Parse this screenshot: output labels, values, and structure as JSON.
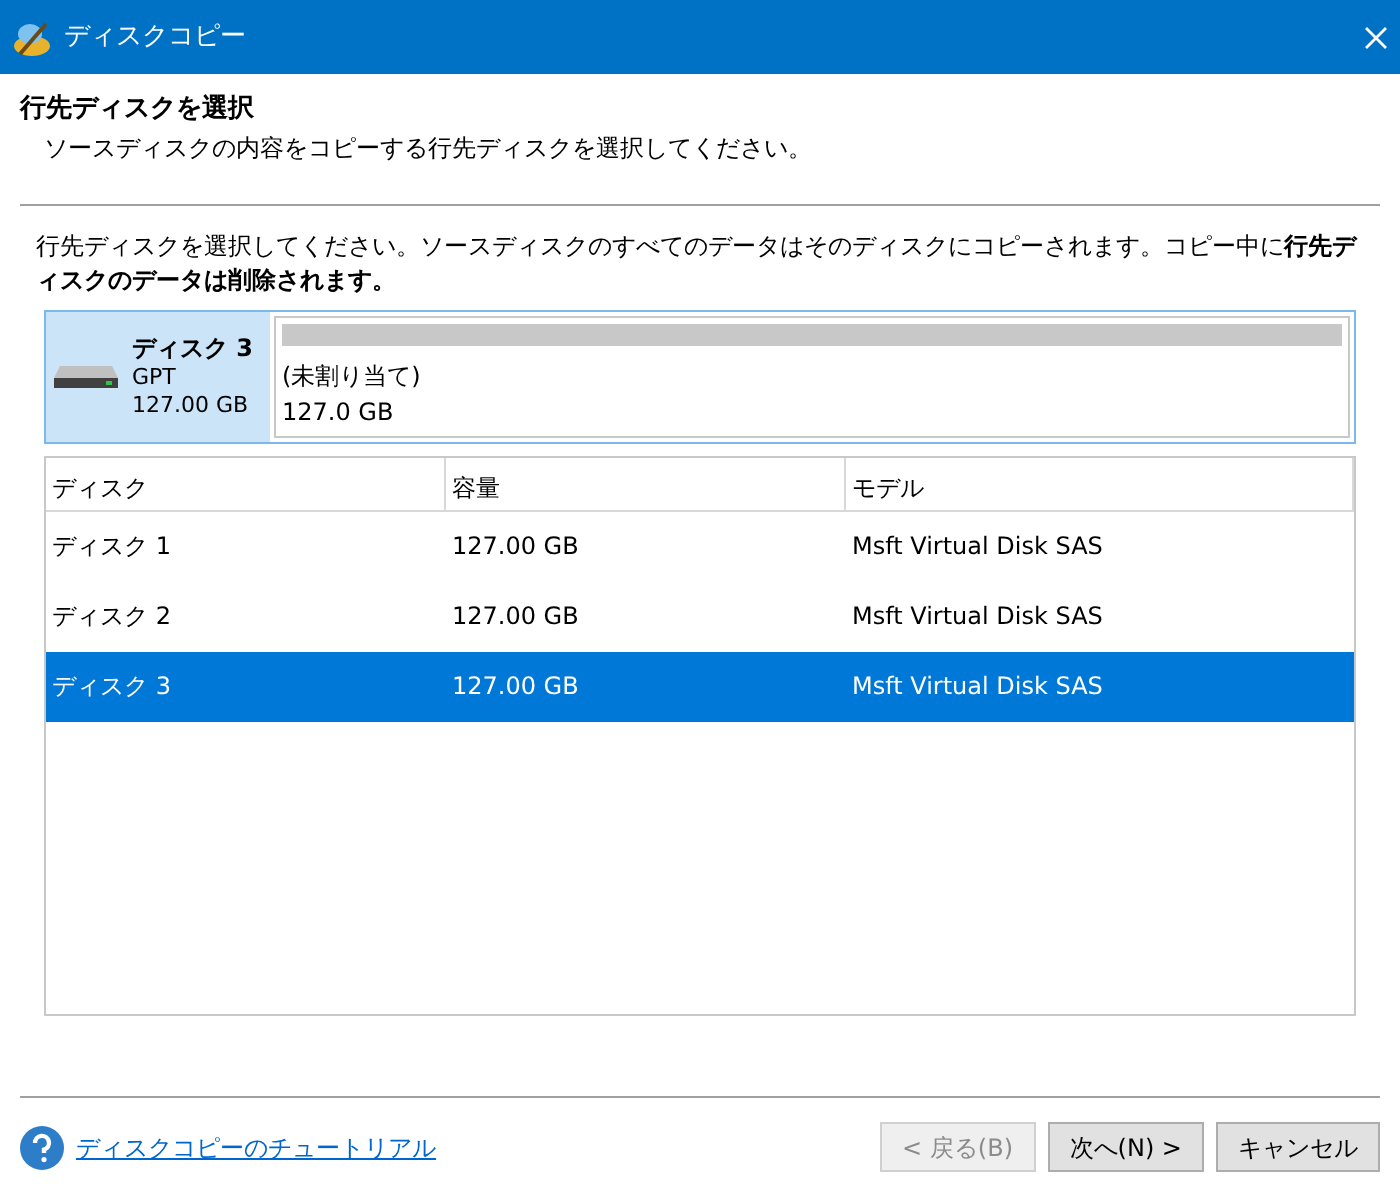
{
  "window": {
    "title": "ディスクコピー"
  },
  "header": {
    "title": "行先ディスクを選択",
    "subtitle": "ソースディスクの内容をコピーする行先ディスクを選択してください。"
  },
  "instruction": "行先ディスクを選択してください。ソースディスクのすべてのデータはそのディスクにコピーされます。コピー中に**行先ディスクのデータは削除されます。**",
  "disk_map": {
    "name": "ディスク 3",
    "type": "GPT",
    "size": "127.00 GB",
    "selected": true,
    "partitions": [
      {
        "label": "(未割り当て)",
        "size": "127.0 GB"
      }
    ]
  },
  "table": {
    "columns": [
      "ディスク",
      "容量",
      "モデル"
    ],
    "rows": [
      {
        "disk": "ディスク 1",
        "capacity": "127.00 GB",
        "model": "Msft Virtual Disk SAS",
        "selected": false
      },
      {
        "disk": "ディスク 2",
        "capacity": "127.00 GB",
        "model": "Msft Virtual Disk SAS",
        "selected": false
      },
      {
        "disk": "ディスク 3",
        "capacity": "127.00 GB",
        "model": "Msft Virtual Disk SAS",
        "selected": true
      }
    ]
  },
  "footer": {
    "tutorial_link": "ディスクコピーのチュートリアル",
    "buttons": [
      {
        "label": "< 戻る(B)",
        "disabled": true
      },
      {
        "label": "次へ(N) >",
        "disabled": false
      },
      {
        "label": "キャンセル",
        "disabled": false
      }
    ]
  }
}
